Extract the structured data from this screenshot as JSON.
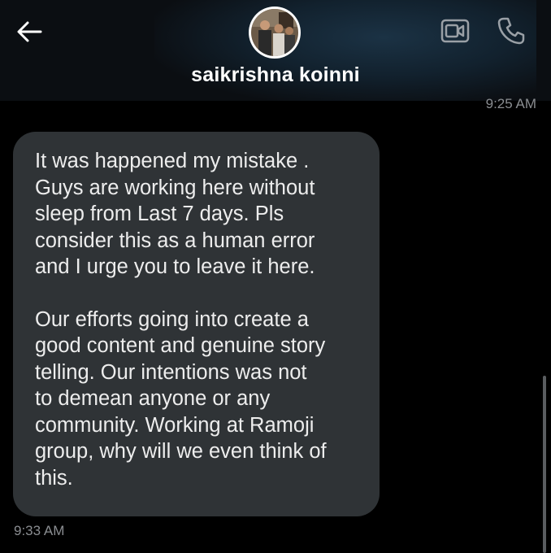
{
  "header": {
    "title": "saikrishna koinni",
    "back_icon": "arrow-left-icon",
    "video_icon": "video-camera-icon",
    "call_icon": "phone-icon"
  },
  "conversation": {
    "previous_timestamp": "9:25 AM",
    "message": {
      "paragraph_1": "It was happened my mistake .\nGuys are working here without\nsleep from Last 7 days. Pls\nconsider this as a human error\nand I urge you to leave it here.",
      "paragraph_2": "Our efforts going into create a\ngood content and genuine story\ntelling. Our intentions was not\nto demean anyone or any\ncommunity. Working at Ramoji\ngroup, why will we even think of\nthis.",
      "timestamp": "9:33 AM"
    }
  },
  "colors": {
    "background": "#000000",
    "bubble": "#2f3336",
    "text": "#ededed",
    "muted": "#8a8d91"
  }
}
